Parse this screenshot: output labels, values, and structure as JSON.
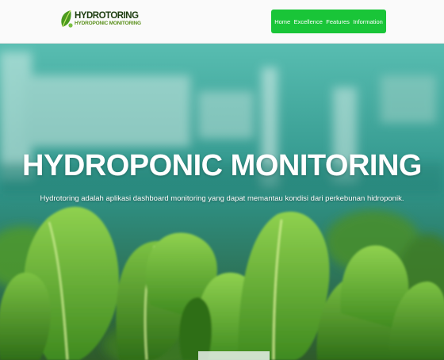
{
  "brand": {
    "name": "HYDROTORING",
    "tagline": "HYDROPONIC MONITORING",
    "logo_icon": "leaf-icon",
    "color": "#1d3d10"
  },
  "nav": {
    "background": "#19c538",
    "items": [
      {
        "label": "Home"
      },
      {
        "label": "Excellence"
      },
      {
        "label": "Features"
      },
      {
        "label": "Information"
      }
    ]
  },
  "hero": {
    "title": "HYDROPONIC MONITORING",
    "description": "Hydrotoring adalah aplikasi dashboard monitoring yang dapat memantau kondisi dari perkebunan hidroponik.",
    "background_image": "lettuce-greenhouse-photo"
  }
}
